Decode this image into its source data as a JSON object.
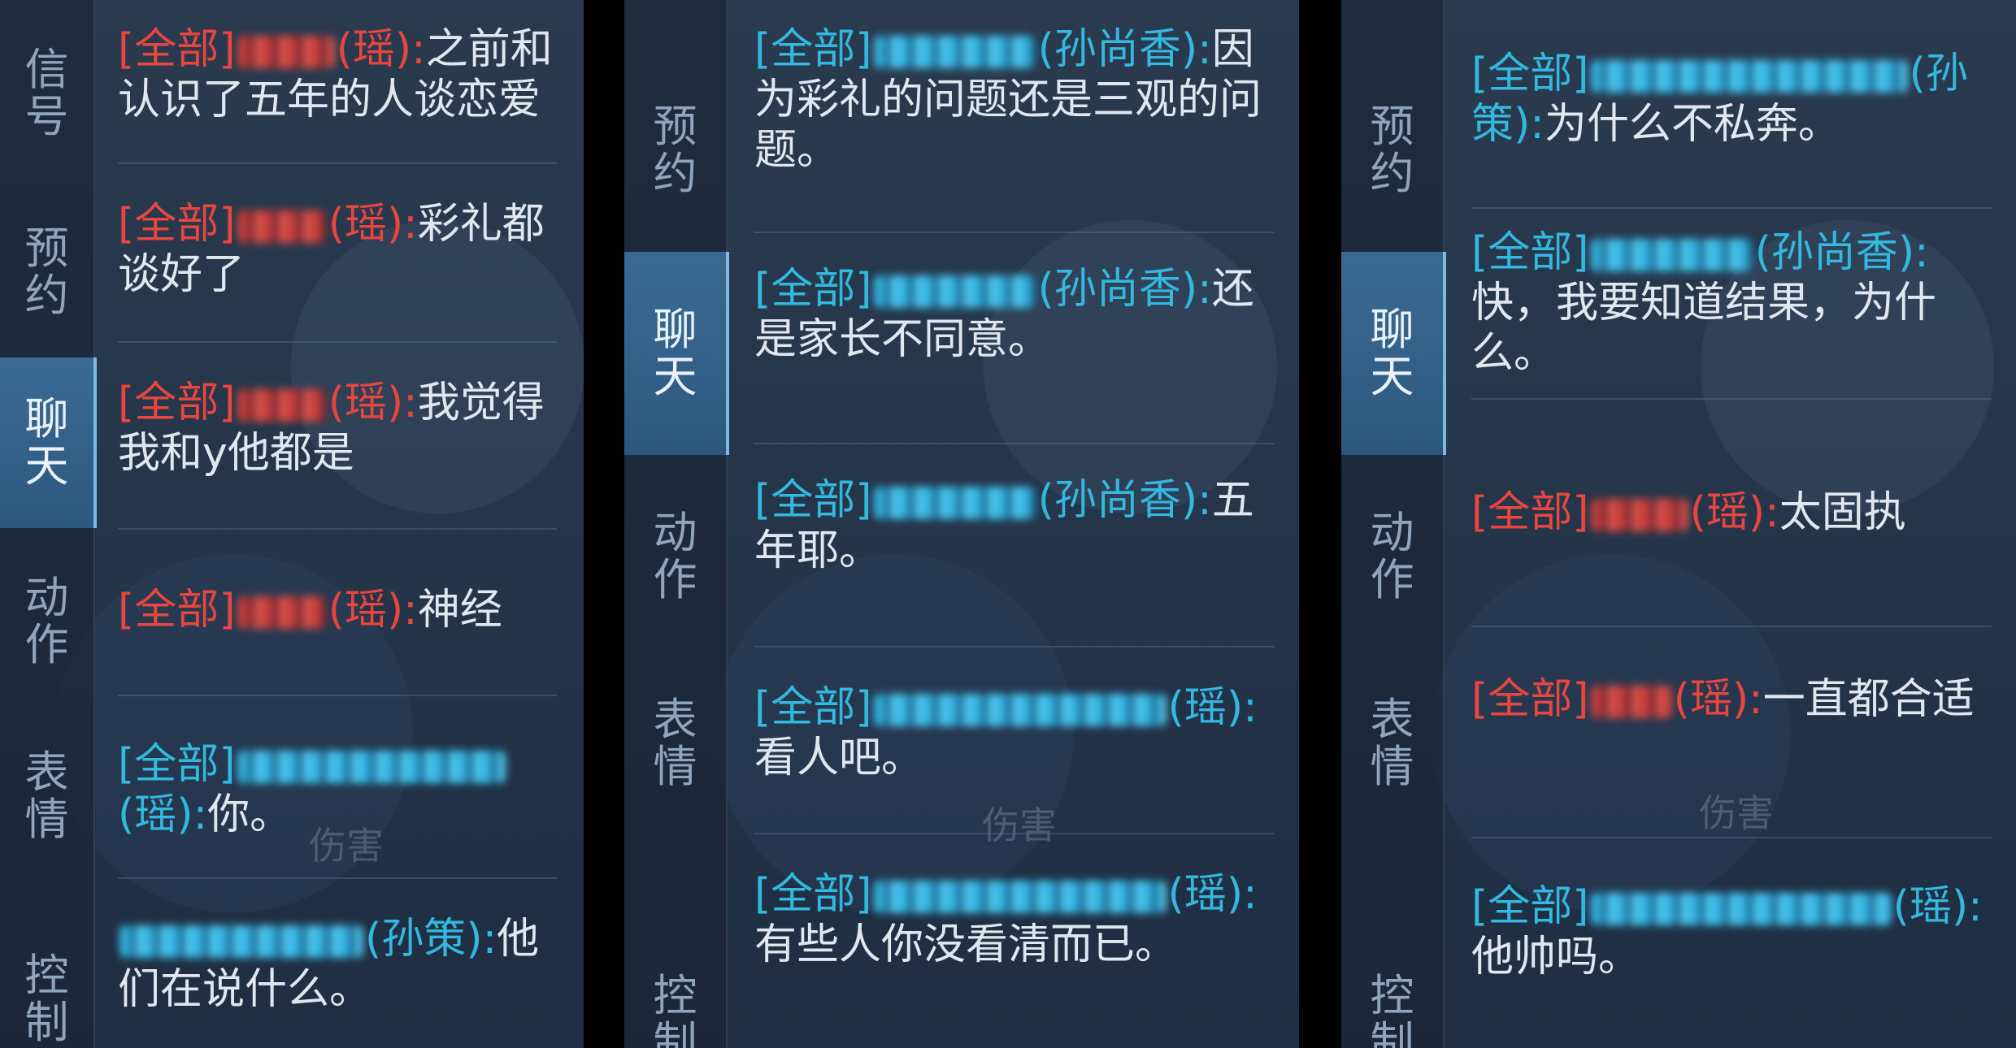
{
  "panels": [
    {
      "tabs": [
        "信号",
        "预约",
        "聊天",
        "动作",
        "表情",
        "控制"
      ],
      "active_tab": "聊天",
      "background_labels": [
        "伤害"
      ],
      "messages": [
        {
          "channel": "[全部]",
          "hero": "(瑶)",
          "colon": ":",
          "text": "之前和认识了五年的人谈恋爱",
          "color": "red"
        },
        {
          "channel": "[全部]",
          "hero": "(瑶)",
          "colon": ":",
          "text": "彩礼都谈好了",
          "color": "red"
        },
        {
          "channel": "[全部]",
          "hero": "(瑶)",
          "colon": ":",
          "text": "我觉得我和y他都是",
          "color": "red"
        },
        {
          "channel": "[全部]",
          "hero": "(瑶)",
          "colon": ":",
          "text": "神经",
          "color": "red"
        },
        {
          "channel": "[全部]",
          "hero": "(瑶)",
          "colon": ":",
          "text": "你。",
          "color": "blue"
        },
        {
          "channel": "",
          "hero": "(孙策)",
          "colon": ":",
          "text": "他们在说什么。",
          "color": "blue"
        }
      ]
    },
    {
      "tabs": [
        "预约",
        "聊天",
        "动作",
        "表情",
        "控制"
      ],
      "active_tab": "聊天",
      "background_labels": [
        "伤害"
      ],
      "messages": [
        {
          "channel": "[全部]",
          "hero": "(孙尚香)",
          "colon": ":",
          "text": "因为彩礼的问题还是三观的问题。",
          "color": "blue"
        },
        {
          "channel": "[全部]",
          "hero": "(孙尚香)",
          "colon": ":",
          "text": "还是家长不同意。",
          "color": "blue"
        },
        {
          "channel": "[全部]",
          "hero": "(孙尚香)",
          "colon": ":",
          "text": "五年耶。",
          "color": "blue"
        },
        {
          "channel": "[全部]",
          "hero": "(瑶)",
          "colon": ":",
          "text": "看人吧。",
          "color": "blue"
        },
        {
          "channel": "[全部]",
          "hero": "(瑶)",
          "colon": ":",
          "text": "有些人你没看清而已。",
          "color": "blue"
        }
      ]
    },
    {
      "tabs": [
        "预约",
        "聊天",
        "动作",
        "表情",
        "控制"
      ],
      "active_tab": "聊天",
      "background_labels": [
        "伤害"
      ],
      "messages": [
        {
          "channel": "[全部]",
          "hero": "(孙策)",
          "colon": ":",
          "text": "为什么不私奔。",
          "color": "blue"
        },
        {
          "channel": "[全部]",
          "hero": "(孙尚香)",
          "colon": ":",
          "text": "快，我要知道结果，为什么。",
          "color": "blue"
        },
        {
          "channel": "[全部]",
          "hero": "(瑶)",
          "colon": ":",
          "text": "太固执",
          "color": "red"
        },
        {
          "channel": "[全部]",
          "hero": "(瑶)",
          "colon": ":",
          "text": "一直都合适",
          "color": "red"
        },
        {
          "channel": "[全部]",
          "hero": "(瑶)",
          "colon": ":",
          "text": "他帅吗。",
          "color": "blue"
        }
      ]
    }
  ],
  "colors": {
    "red_channel": "#e8463f",
    "blue_channel": "#33b8df",
    "body_text": "#dfe7f0",
    "active_tab": "#2d587e",
    "panel_bg": "#26374b"
  }
}
